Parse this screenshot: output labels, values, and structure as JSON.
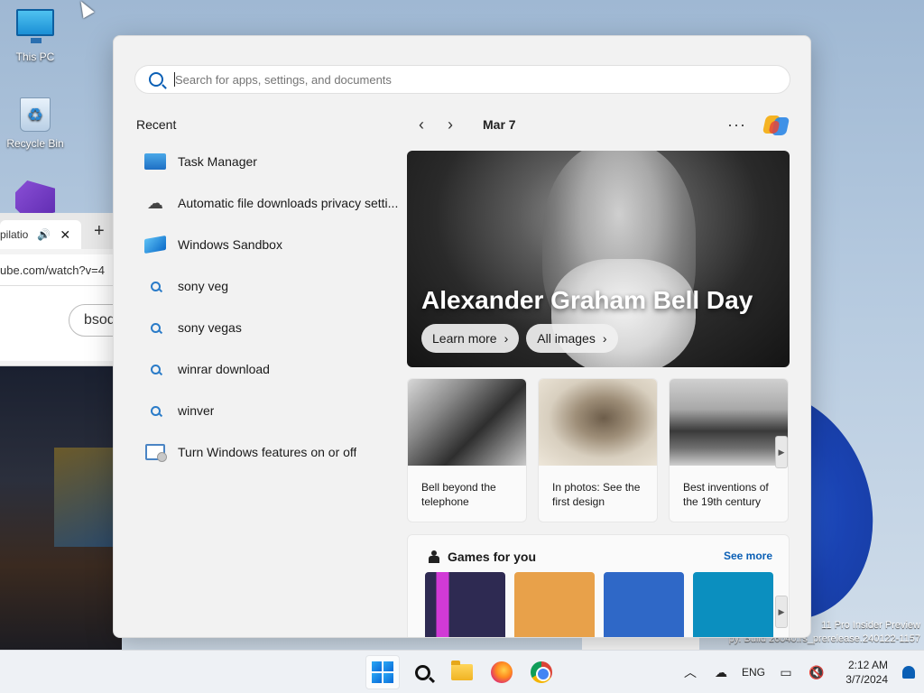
{
  "desktop": {
    "icons": [
      {
        "label": "This PC"
      },
      {
        "label": "Recycle Bin"
      }
    ],
    "watermark": {
      "line1": "11 Pro Insider Preview",
      "line2": "py. Build 26040.rs_prerelease.240122-1157"
    }
  },
  "browser": {
    "tab_label": "pilatio",
    "address": "ube.com/watch?v=4",
    "search_value": "bsod"
  },
  "start": {
    "search": {
      "placeholder": "Search for apps, settings, and documents"
    },
    "recent_heading": "Recent",
    "recent_items": [
      {
        "label": "Task Manager",
        "icon": "task-manager-icon"
      },
      {
        "label": "Automatic file downloads privacy setti...",
        "icon": "cloud-icon"
      },
      {
        "label": "Windows Sandbox",
        "icon": "sandbox-icon"
      },
      {
        "label": "sony veg",
        "icon": "search-icon"
      },
      {
        "label": "sony vegas",
        "icon": "search-icon"
      },
      {
        "label": "winrar download",
        "icon": "search-icon"
      },
      {
        "label": "winver",
        "icon": "search-icon"
      },
      {
        "label": "Turn Windows features on or off",
        "icon": "windows-features-icon"
      }
    ],
    "feed": {
      "date": "Mar 7",
      "more_label": "···",
      "hero": {
        "title": "Alexander Graham Bell Day",
        "learn_more": "Learn more",
        "all_images": "All images"
      },
      "cards": [
        {
          "caption": "Bell beyond the telephone"
        },
        {
          "caption": "In photos: See the first design"
        },
        {
          "caption": "Best inventions of the 19th century"
        }
      ],
      "games": {
        "heading": "Games for you",
        "see_more": "See more",
        "tile_colors": [
          "#2e2a52",
          "#e8a14a",
          "#2f68c7",
          "#0b8fbf"
        ]
      }
    }
  },
  "taskbar": {
    "tray": {
      "language": "ENG",
      "time": "2:12 AM",
      "date": "3/7/2024"
    }
  }
}
